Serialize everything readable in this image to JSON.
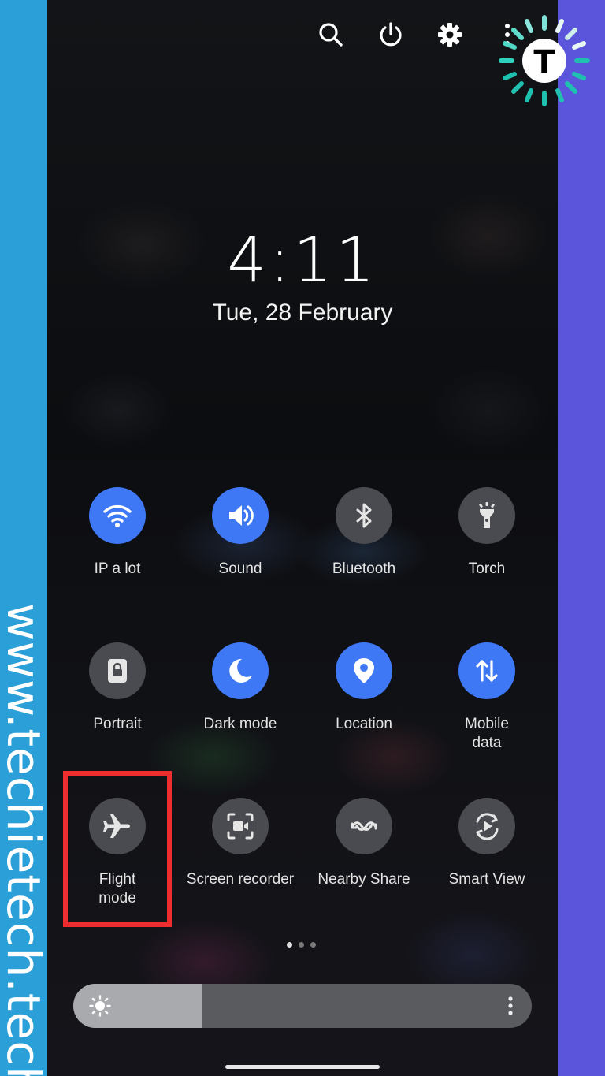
{
  "watermark": {
    "text": "www.techietech.tech",
    "logo_letter": "T"
  },
  "header_icons": [
    "search-icon",
    "power-icon",
    "settings-icon",
    "more-vert-icon"
  ],
  "lockscreen": {
    "time": "4:11",
    "date": "Tue, 28 February"
  },
  "quick_settings": {
    "tiles": [
      {
        "label": "IP a lot",
        "icon": "wifi-icon",
        "state": "on"
      },
      {
        "label": "Sound",
        "icon": "volume-icon",
        "state": "on"
      },
      {
        "label": "Bluetooth",
        "icon": "bluetooth-icon",
        "state": "off"
      },
      {
        "label": "Torch",
        "icon": "torch-icon",
        "state": "off"
      },
      {
        "label": "Portrait",
        "icon": "portrait-lock-icon",
        "state": "off"
      },
      {
        "label": "Dark mode",
        "icon": "moon-icon",
        "state": "on"
      },
      {
        "label": "Location",
        "icon": "location-pin-icon",
        "state": "on"
      },
      {
        "label": "Mobile\ndata",
        "icon": "mobile-data-icon",
        "state": "on"
      },
      {
        "label": "Flight\nmode",
        "icon": "airplane-icon",
        "state": "off"
      },
      {
        "label": "Screen recorder",
        "icon": "screen-recorder-icon",
        "state": "off"
      },
      {
        "label": "Nearby Share",
        "icon": "nearby-share-icon",
        "state": "off"
      },
      {
        "label": "Smart View",
        "icon": "smart-view-icon",
        "state": "off"
      }
    ],
    "page_count": 3,
    "active_page": 1
  },
  "brightness": {
    "level": 0.28
  },
  "colors": {
    "tile_on": "#3e78f5",
    "tile_off": "#4a4b50",
    "highlight": "#ee2e2e",
    "left_strip": "#2a9fd8",
    "right_strip": "#5b55dc"
  }
}
